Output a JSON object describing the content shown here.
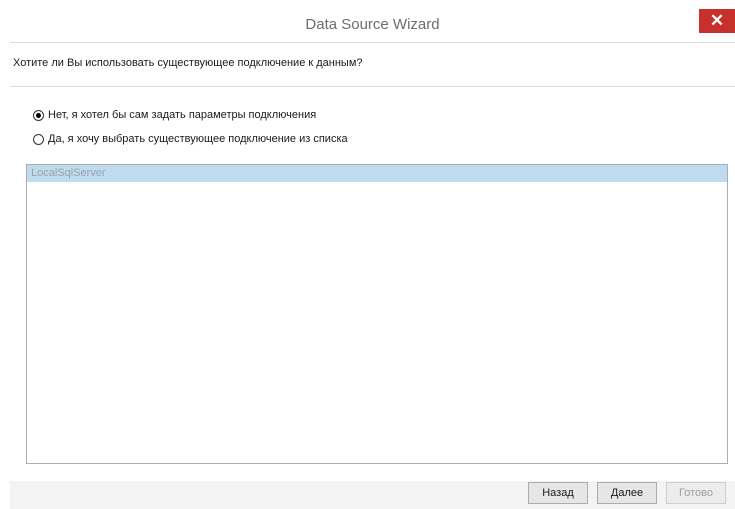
{
  "window": {
    "title": "Data Source Wizard",
    "close_glyph": "✕"
  },
  "header": {
    "question": "Хотите ли Вы использовать существующее подключение к данным?"
  },
  "options": [
    {
      "label": "Нет, я хотел бы сам задать параметры подключения",
      "checked": true
    },
    {
      "label": "Да, я хочу выбрать существующее подключение из списка",
      "checked": false
    }
  ],
  "connections": [
    {
      "label": "LocalSqlServer",
      "selected": true
    }
  ],
  "footer": {
    "back_label": "Назад",
    "next_label": "Далее",
    "finish_label": "Готово"
  },
  "colors": {
    "close_button": "#c7302b",
    "selection": "#bfdbef"
  }
}
